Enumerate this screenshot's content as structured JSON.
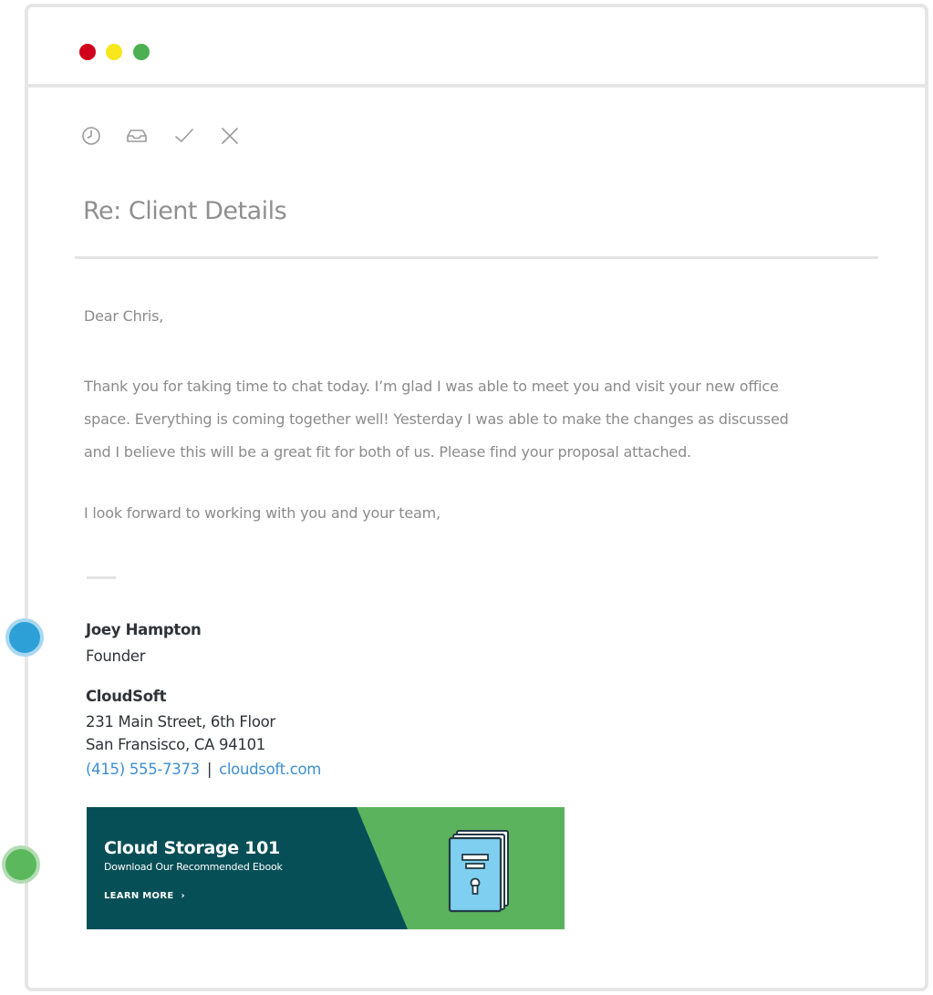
{
  "window_controls": {
    "close_color": "#d0021b",
    "minimize_color": "#f8e71c",
    "maximize_color": "#4caf50"
  },
  "toolbar": {
    "icons": [
      "clock-icon",
      "inbox-icon",
      "check-icon",
      "close-icon"
    ]
  },
  "email": {
    "subject": "Re: Client Details",
    "greeting": "Dear Chris,",
    "paragraph_lines": [
      "Thank you for taking time to chat today. I’m glad I was able to meet you and visit your new office",
      "space. Everything is coming together well! Yesterday I was able to make the changes as discussed",
      "and I believe this will be a great fit for both of us.  Please find your proposal attached."
    ],
    "closing": "I look forward to working with you and your team,"
  },
  "signature": {
    "name": "Joey Hampton",
    "title": "Founder",
    "company": "CloudSoft",
    "address_line1": "231 Main Street, 6th Floor",
    "address_line2": "San Fransisco,  CA  94101",
    "phone": "(415) 555-7373",
    "separator": "|",
    "website": "cloudsoft.com",
    "link_color": "#3d8fd0"
  },
  "banner": {
    "title": "Cloud Storage 101",
    "subtitle": "Download Our Recommended Ebook",
    "cta": "LEARN MORE",
    "cta_arrow": "›",
    "dark_color": "#074f57",
    "green_color": "#5cb35e",
    "book_color": "#7ecff0",
    "book_icon": "ebook-icon"
  },
  "side_markers": {
    "blue_color": "#2ea0d8",
    "green_color": "#5cb85c"
  }
}
